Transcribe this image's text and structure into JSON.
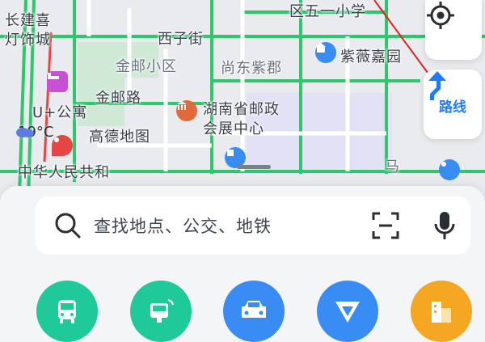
{
  "map": {
    "labels": {
      "changjianxi": "长建喜",
      "dengshicheng": "灯饰城",
      "xizijie": "西子街",
      "jinyouxiaoqu": "金邮小区",
      "shangdongzijun": "尚东紫郡",
      "ziweijiayuan": "紫薇嘉园",
      "jinyoulu": "金邮路",
      "hunansheng": "湖南省邮政",
      "huizhanzhongxin": "会展中心",
      "ugongyu": "U+公寓",
      "gaode": "高德地图",
      "zhonghua": "中华人民共和",
      "quwuyixiaoxue": "区五一小学",
      "ma": "马"
    },
    "weather": {
      "temperature": "19°C",
      "icon": "cloud-icon"
    }
  },
  "controls": {
    "locate_icon": "locate-icon",
    "route_label": "路线",
    "route_color": "#1f7bff"
  },
  "search": {
    "placeholder": "查找地点、公交、地铁",
    "search_icon": "search-icon",
    "scan_icon": "scan-icon",
    "mic_icon": "microphone-icon"
  },
  "categories": [
    {
      "name": "bus",
      "icon": "bus-icon",
      "color": "#20c99a"
    },
    {
      "name": "metro",
      "icon": "metro-icon",
      "color": "#20c99a"
    },
    {
      "name": "car",
      "icon": "car-icon",
      "color": "#3a8cf5"
    },
    {
      "name": "navigation",
      "icon": "navigation-icon",
      "color": "#3a8cf5"
    },
    {
      "name": "building",
      "icon": "building-icon",
      "color": "#f5a623"
    }
  ]
}
